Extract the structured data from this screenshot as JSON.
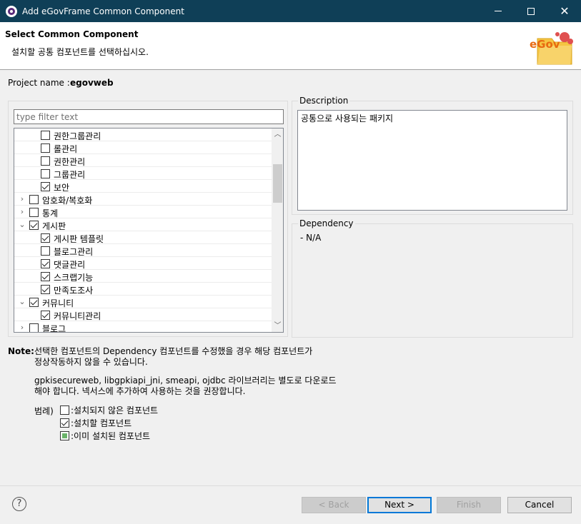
{
  "window": {
    "title": "Add eGovFrame Common Component",
    "controls": [
      "minimize-icon",
      "maximize-icon",
      "close-icon"
    ]
  },
  "header": {
    "title": "Select Common Component",
    "subtitle": "설치할 공통 컴포넌트를 선택하십시오.",
    "logo_text": "eGov"
  },
  "project": {
    "label": "Project name :",
    "name": "egovweb"
  },
  "filter": {
    "placeholder": "type filter text",
    "value": ""
  },
  "tree": {
    "items": [
      {
        "label": "권한그룹관리",
        "level": 2,
        "checked": false,
        "expander": ""
      },
      {
        "label": "롤관리",
        "level": 2,
        "checked": false,
        "expander": ""
      },
      {
        "label": "권한관리",
        "level": 2,
        "checked": false,
        "expander": ""
      },
      {
        "label": "그룹관리",
        "level": 2,
        "checked": false,
        "expander": ""
      },
      {
        "label": "보안",
        "level": 2,
        "checked": true,
        "expander": ""
      },
      {
        "label": "암호화/복호화",
        "level": 1,
        "checked": false,
        "expander": "›"
      },
      {
        "label": "통계",
        "level": 1,
        "checked": false,
        "expander": "›"
      },
      {
        "label": "게시판",
        "level": 1,
        "checked": true,
        "expander": "⌄"
      },
      {
        "label": "게시판 템플릿",
        "level": 2,
        "checked": true,
        "expander": ""
      },
      {
        "label": "블로그관리",
        "level": 2,
        "checked": false,
        "expander": ""
      },
      {
        "label": "댓글관리",
        "level": 2,
        "checked": true,
        "expander": ""
      },
      {
        "label": "스크랩기능",
        "level": 2,
        "checked": true,
        "expander": ""
      },
      {
        "label": "만족도조사",
        "level": 2,
        "checked": true,
        "expander": ""
      },
      {
        "label": "커뮤니티",
        "level": 1,
        "checked": true,
        "expander": "⌄"
      },
      {
        "label": "커뮤니티관리",
        "level": 2,
        "checked": true,
        "expander": ""
      },
      {
        "label": "블로그",
        "level": 1,
        "checked": false,
        "expander": "›"
      }
    ]
  },
  "description": {
    "label": "Description",
    "text": "공통으로 사용되는 패키지"
  },
  "dependency": {
    "label": "Dependency",
    "text": "- N/A"
  },
  "note": {
    "label": "Note:",
    "line1": "선택한 컴포넌트의 Dependency 컴포넌트를 수정했을 경우 해당 컴포넌트가",
    "line2": "정상작동하지 않을 수 있습니다.",
    "line3": "gpkisecureweb, libgpkiapi_jni, smeapi, ojdbc 라이브러리는 별도로 다운로드",
    "line4": "해야 합니다. 넥서스에 추가하여 사용하는 것을 권장합니다."
  },
  "legend": {
    "title": "범례)",
    "items": [
      {
        "label": ":설치되지 않은 컴포넌트",
        "state": "unchecked"
      },
      {
        "label": ":설치할 컴포넌트",
        "state": "checked"
      },
      {
        "label": ":이미 설치된 컴포넌트",
        "state": "installed"
      }
    ]
  },
  "buttons": {
    "back": "< Back",
    "next": "Next >",
    "finish": "Finish",
    "cancel": "Cancel",
    "help": "?"
  },
  "colors": {
    "titlebar": "#0f3f57",
    "installed_marker": "#6ab36a",
    "default_button_border": "#0078d7"
  }
}
